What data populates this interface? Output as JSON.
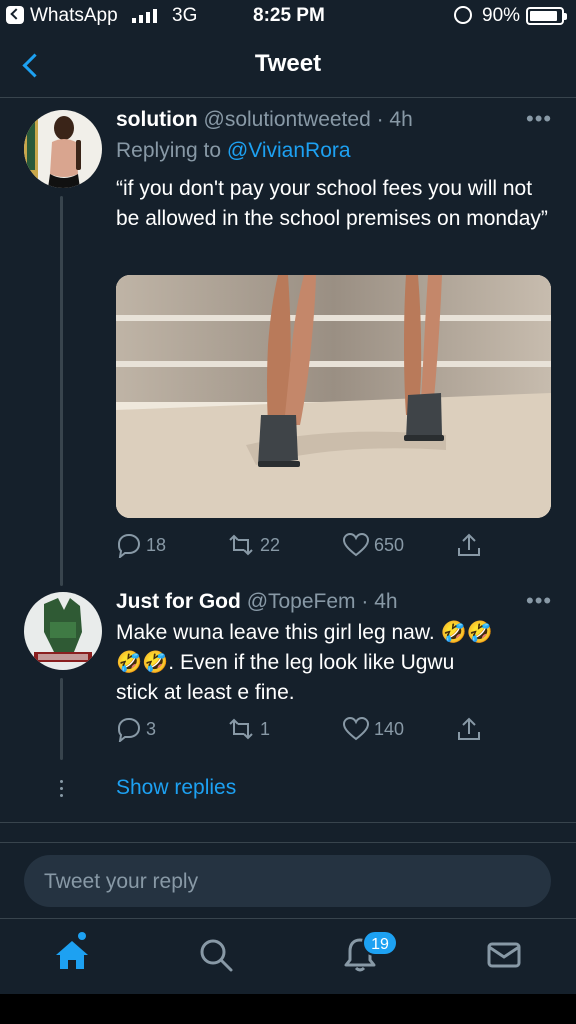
{
  "status_bar": {
    "app": "WhatsApp",
    "network": "3G",
    "time": "8:25 PM",
    "battery": "90%"
  },
  "header": {
    "title": "Tweet"
  },
  "tweets": [
    {
      "display_name": "solution",
      "handle": "@solutiontweeted",
      "time": "· 4h",
      "replying_prefix": "Replying to",
      "replying_to": "@VivianRora",
      "text": "“if you don't pay your school fees you will not be allowed in the school premises on monday”",
      "replies": "18",
      "retweets": "22",
      "likes": "650"
    },
    {
      "display_name": "Just for God",
      "handle": "@TopeFem",
      "time": "· 4h",
      "text_line1": "Make wuna leave this girl leg naw. 🤣🤣",
      "text_line2": "🤣🤣. Even if the leg look like Ugwu",
      "text_line3": "stick at least e fine.",
      "replies": "3",
      "retweets": "1",
      "likes": "140"
    }
  ],
  "show_replies": "Show replies",
  "reply_bar": {
    "placeholder": "Tweet your reply"
  },
  "tab_bar": {
    "notification_count": "19"
  },
  "colors": {
    "background": "#15202b",
    "accent": "#1da1f2",
    "muted": "#8899a6",
    "border": "#38444d"
  }
}
